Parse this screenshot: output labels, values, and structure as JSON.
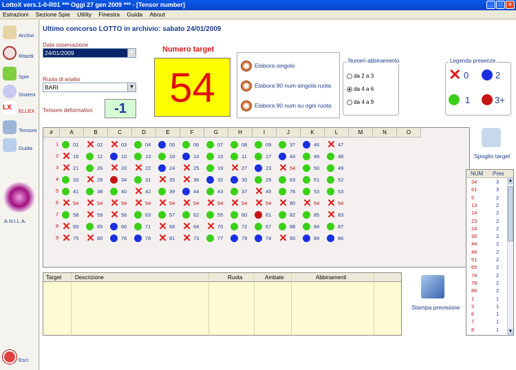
{
  "window": {
    "title": "LottoX vers.1-0-R01  ***  Oggi 27 gen 2009  ***  - [Tensor number]"
  },
  "menu": [
    "Estrazioni",
    "Sezione Spie",
    "Utility",
    "Finestra",
    "Guida",
    "About"
  ],
  "leftbar": [
    {
      "label": "Archivi",
      "icon": "pencil-icon"
    },
    {
      "label": "Ritardi",
      "icon": "clock-icon"
    },
    {
      "label": "Spie",
      "icon": "spy-icon"
    },
    {
      "label": "Sistemi",
      "icon": "bulb-icon"
    },
    {
      "label": "ELLEX",
      "icon": "ellex-logo"
    },
    {
      "label": "Tensore",
      "icon": "tensor-icon"
    },
    {
      "label": "Guida",
      "icon": "book-icon"
    },
    {
      "label": "A.N.I.L.A.",
      "icon": "anila-logo"
    },
    {
      "label": "Esci",
      "icon": "exit-icon"
    }
  ],
  "header": {
    "last_draw": "Ultimo concorso LOTTO in archivio: sabato 24/01/2009"
  },
  "controls": {
    "data_label": "Data osservazione",
    "data_value": "24/01/2009",
    "ruota_label": "Ruota di analisi",
    "ruota_value": "BARI",
    "tensore_label": "Tensore deformativo",
    "tensore_value": "-1"
  },
  "target": {
    "label": "Numero target",
    "value": "54"
  },
  "actions": [
    "Elabora singolo",
    "Elabora 90 num singola ruota",
    "Elabora 90 num su ogni ruota"
  ],
  "abbinamento": {
    "title": "Numeri abbinamento",
    "options": [
      "da 2 a 3",
      "da 4 a 6",
      "da 4 a 9"
    ],
    "selected": 1
  },
  "legenda": {
    "title": "Legenda presenze",
    "items": [
      "0",
      "2",
      "1",
      "3+"
    ]
  },
  "grid": {
    "columns": [
      "#",
      "A",
      "B",
      "C",
      "D",
      "E",
      "F",
      "G",
      "H",
      "I",
      "J",
      "K",
      "L",
      "M",
      "N",
      "O"
    ],
    "rows": [
      {
        "r": "1",
        "cells": [
          [
            "g",
            "01"
          ],
          [
            "x",
            "02"
          ],
          [
            "x",
            "03"
          ],
          [
            "g",
            "04"
          ],
          [
            "b",
            "05"
          ],
          [
            "g",
            "06"
          ],
          [
            "g",
            "07"
          ],
          [
            "g",
            "08"
          ],
          [
            "g",
            "09"
          ],
          [
            "g",
            "37"
          ],
          [
            "b",
            "46"
          ],
          [
            "x",
            "47"
          ]
        ]
      },
      {
        "r": "2",
        "cells": [
          [
            "x",
            "16"
          ],
          [
            "g",
            "12"
          ],
          [
            "b",
            "10"
          ],
          [
            "g",
            "13"
          ],
          [
            "g",
            "18"
          ],
          [
            "b",
            "14"
          ],
          [
            "g",
            "15"
          ],
          [
            "g",
            "11"
          ],
          [
            "g",
            "17"
          ],
          [
            "b",
            "44"
          ],
          [
            "g",
            "49"
          ],
          [
            "g",
            "48"
          ]
        ]
      },
      {
        "r": "3",
        "cells": [
          [
            "x",
            "21"
          ],
          [
            "g",
            "26"
          ],
          [
            "x",
            "20"
          ],
          [
            "x",
            "22"
          ],
          [
            "b",
            "24"
          ],
          [
            "x",
            "25"
          ],
          [
            "g",
            "19"
          ],
          [
            "x",
            "27"
          ],
          [
            "b",
            "23"
          ],
          [
            "x",
            "54"
          ],
          [
            "g",
            "50"
          ],
          [
            "g",
            "49"
          ]
        ]
      },
      {
        "r": "4",
        "cells": [
          [
            "g",
            "33"
          ],
          [
            "x",
            "28"
          ],
          [
            "r",
            "34"
          ],
          [
            "g",
            "31"
          ],
          [
            "x",
            "35"
          ],
          [
            "x",
            "36"
          ],
          [
            "b",
            "32"
          ],
          [
            "b",
            "30"
          ],
          [
            "g",
            "29"
          ],
          [
            "g",
            "63"
          ],
          [
            "g",
            "51"
          ],
          [
            "g",
            "52"
          ]
        ]
      },
      {
        "r": "5",
        "cells": [
          [
            "g",
            "41"
          ],
          [
            "g",
            "38"
          ],
          [
            "g",
            "40"
          ],
          [
            "x",
            "42"
          ],
          [
            "g",
            "39"
          ],
          [
            "b",
            "44"
          ],
          [
            "g",
            "43"
          ],
          [
            "g",
            "37"
          ],
          [
            "x",
            "45"
          ],
          [
            "g",
            "76"
          ],
          [
            "g",
            "53"
          ],
          [
            "g",
            "53"
          ]
        ]
      },
      {
        "r": "6",
        "cells": [
          [
            "x",
            "54"
          ],
          [
            "x",
            "54"
          ],
          [
            "x",
            "54"
          ],
          [
            "x",
            "54"
          ],
          [
            "x",
            "54"
          ],
          [
            "x",
            "54"
          ],
          [
            "x",
            "54"
          ],
          [
            "x",
            "54"
          ],
          [
            "x",
            "54"
          ],
          [
            "x",
            "80"
          ],
          [
            "x",
            "54"
          ],
          [
            "x",
            "54"
          ]
        ]
      },
      {
        "r": "7",
        "cells": [
          [
            "g",
            "58"
          ],
          [
            "x",
            "59"
          ],
          [
            "x",
            "56"
          ],
          [
            "g",
            "63"
          ],
          [
            "g",
            "57"
          ],
          [
            "g",
            "62"
          ],
          [
            "g",
            "55"
          ],
          [
            "g",
            "60"
          ],
          [
            "r",
            "61"
          ],
          [
            "g",
            "82"
          ],
          [
            "g",
            "85"
          ],
          [
            "x",
            "83"
          ]
        ]
      },
      {
        "r": "8",
        "cells": [
          [
            "x",
            "69"
          ],
          [
            "g",
            "65"
          ],
          [
            "b",
            "66"
          ],
          [
            "g",
            "71"
          ],
          [
            "x",
            "68"
          ],
          [
            "x",
            "64"
          ],
          [
            "x",
            "70"
          ],
          [
            "g",
            "72"
          ],
          [
            "g",
            "67"
          ],
          [
            "g",
            "88"
          ],
          [
            "g",
            "84"
          ],
          [
            "g",
            "87"
          ]
        ]
      },
      {
        "r": "9",
        "cells": [
          [
            "x",
            "75"
          ],
          [
            "x",
            "80"
          ],
          [
            "b",
            "76"
          ],
          [
            "b",
            "78"
          ],
          [
            "x",
            "81"
          ],
          [
            "x",
            "73"
          ],
          [
            "g",
            "77"
          ],
          [
            "b",
            "79"
          ],
          [
            "b",
            "74"
          ],
          [
            "x",
            "90"
          ],
          [
            "b",
            "89"
          ],
          [
            "b",
            "86"
          ]
        ]
      }
    ]
  },
  "bottom_table": {
    "headers": [
      "Target",
      "Descrizione",
      "Ruota",
      "Ambate",
      "Abbinamenti"
    ]
  },
  "buttons": {
    "spoglio": "Spoglio target",
    "stampa": "Stampa previsione"
  },
  "side_table": {
    "headers": [
      "NUM",
      "Pres"
    ],
    "rows": [
      [
        "34",
        "3"
      ],
      [
        "61",
        "3"
      ],
      [
        "5",
        "2"
      ],
      [
        "13",
        "2"
      ],
      [
        "14",
        "2"
      ],
      [
        "23",
        "2"
      ],
      [
        "24",
        "2"
      ],
      [
        "30",
        "2"
      ],
      [
        "44",
        "2"
      ],
      [
        "46",
        "2"
      ],
      [
        "51",
        "2"
      ],
      [
        "65",
        "2"
      ],
      [
        "74",
        "2"
      ],
      [
        "78",
        "2"
      ],
      [
        "86",
        "2"
      ],
      [
        "1",
        "1"
      ],
      [
        "3",
        "1"
      ],
      [
        "6",
        "1"
      ],
      [
        "7",
        "1"
      ],
      [
        "8",
        "1"
      ]
    ]
  }
}
